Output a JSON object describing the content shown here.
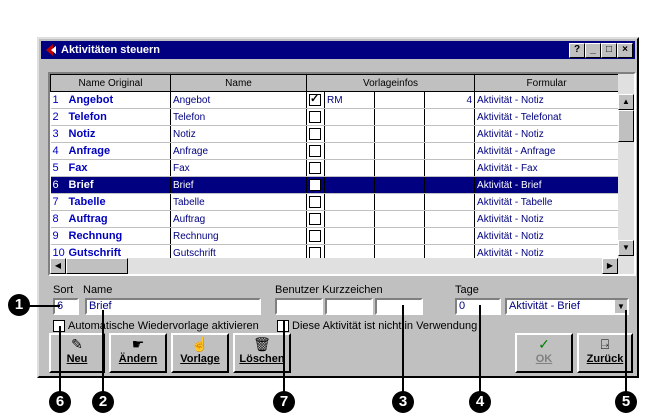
{
  "window": {
    "title": "Aktivitäten steuern",
    "title_buttons": [
      "?",
      "_",
      "□",
      "×"
    ]
  },
  "grid": {
    "columns": [
      "Name Original",
      "Name",
      "Vorlageinfos",
      "Formular"
    ],
    "rows": [
      {
        "num": "1",
        "orig": "Angebot",
        "name": "Angebot",
        "checked": true,
        "info": "RM",
        "count": "4",
        "form": "Aktivität - Notiz"
      },
      {
        "num": "2",
        "orig": "Telefon",
        "name": "Telefon",
        "checked": false,
        "info": "",
        "count": "",
        "form": "Aktivität - Telefonat"
      },
      {
        "num": "3",
        "orig": "Notiz",
        "name": "Notiz",
        "checked": false,
        "info": "",
        "count": "",
        "form": "Aktivität - Notiz"
      },
      {
        "num": "4",
        "orig": "Anfrage",
        "name": "Anfrage",
        "checked": false,
        "info": "",
        "count": "",
        "form": "Aktivität - Anfrage"
      },
      {
        "num": "5",
        "orig": "Fax",
        "name": "Fax",
        "checked": false,
        "info": "",
        "count": "",
        "form": "Aktivität - Fax"
      },
      {
        "num": "6",
        "orig": "Brief",
        "name": "Brief",
        "checked": false,
        "info": "",
        "count": "",
        "form": "Aktivität - Brief",
        "selected": true
      },
      {
        "num": "7",
        "orig": "Tabelle",
        "name": "Tabelle",
        "checked": false,
        "info": "",
        "count": "",
        "form": "Aktivität - Tabelle"
      },
      {
        "num": "8",
        "orig": "Auftrag",
        "name": "Auftrag",
        "checked": false,
        "info": "",
        "count": "",
        "form": "Aktivität - Notiz"
      },
      {
        "num": "9",
        "orig": "Rechnung",
        "name": "Rechnung",
        "checked": false,
        "info": "",
        "count": "",
        "form": "Aktivität - Notiz"
      },
      {
        "num": "10",
        "orig": "Gutschrift",
        "name": "Gutschrift",
        "checked": false,
        "info": "",
        "count": "",
        "form": "Aktivität - Notiz"
      }
    ]
  },
  "form": {
    "sort_label": "Sort",
    "sort_value": "6",
    "name_label": "Name",
    "name_value": "Brief",
    "kurz_label": "Benutzer Kurzzeichen",
    "kurz_values": [
      "",
      "",
      ""
    ],
    "tage_label": "Tage",
    "tage_value": "0",
    "formular_value": "Aktivität - Brief",
    "auto_wv_label": "Automatische Wiedervorlage aktivieren",
    "not_used_label": "Diese Aktivität ist nicht in Verwendung"
  },
  "buttons": {
    "neu": "Neu",
    "aendern": "Ändern",
    "vorlage": "Vorlage",
    "loeschen": "Löschen",
    "ok": "OK",
    "zurueck": "Zurück"
  },
  "callouts": [
    "1",
    "2",
    "3",
    "4",
    "5",
    "6",
    "7"
  ],
  "colors": {
    "titlebar": "#000080",
    "selection": "#000080",
    "dialog": "#c0c0c0"
  }
}
